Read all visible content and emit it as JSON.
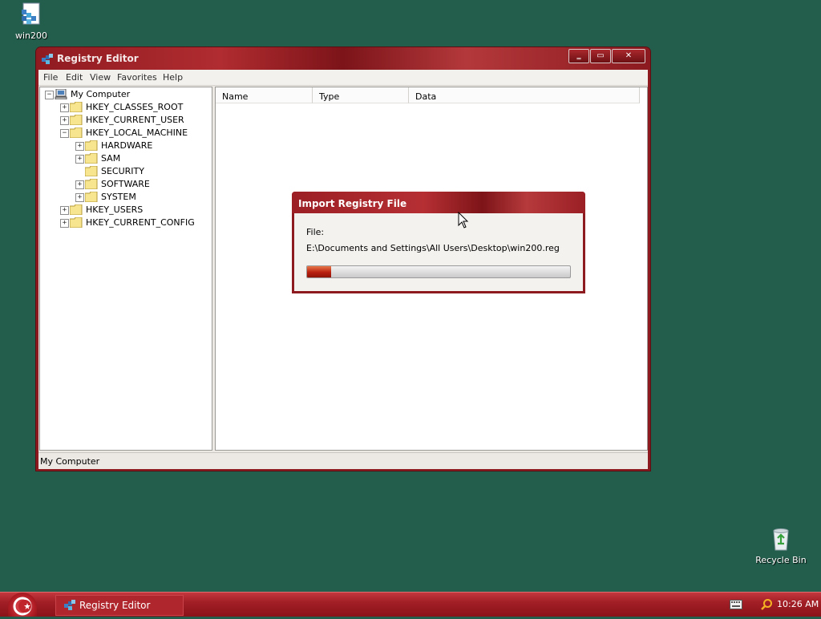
{
  "desktop": {
    "icons": [
      {
        "label": "win200",
        "icon": "registry-file-icon"
      },
      {
        "label": "Recycle Bin",
        "icon": "recycle-bin-icon"
      }
    ]
  },
  "window": {
    "title": "Registry Editor",
    "buttons": {
      "minimize": "‗",
      "maximize": "▭",
      "close": "✕"
    },
    "menu": [
      "File",
      "Edit",
      "View",
      "Favorites",
      "Help"
    ],
    "tree": {
      "root": "My Computer",
      "hives": [
        "HKEY_CLASSES_ROOT",
        "HKEY_CURRENT_USER",
        "HKEY_LOCAL_MACHINE",
        "HKEY_USERS",
        "HKEY_CURRENT_CONFIG"
      ],
      "local_machine_children": [
        "HARDWARE",
        "SAM",
        "SECURITY",
        "SOFTWARE",
        "SYSTEM"
      ],
      "expand": "+",
      "collapse": "−"
    },
    "columns": [
      "Name",
      "Type",
      "Data"
    ],
    "status": "My Computer"
  },
  "dialog": {
    "title": "Import Registry File",
    "file_label": "File:",
    "file_path": "E:\\Documents and Settings\\All Users\\Desktop\\win200.reg",
    "progress": 0.09
  },
  "taskbar": {
    "task_label": "Registry Editor",
    "clock": "10:26 AM"
  },
  "colors": {
    "desktop": "#235e4c",
    "window_frame": "#8c1a1f",
    "taskbar": "#a21f26",
    "progress_fill": "#b8200f"
  }
}
